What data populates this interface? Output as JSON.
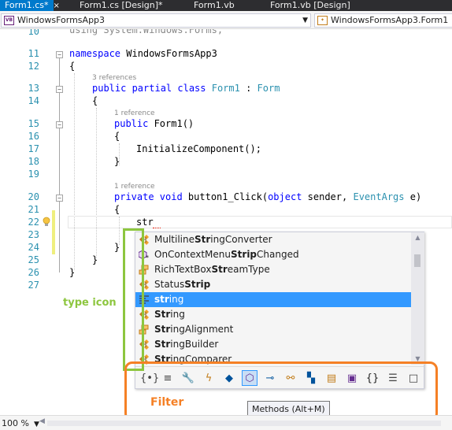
{
  "tabs": [
    {
      "label": "Form1.cs*",
      "active": true
    },
    {
      "label": "Form1.cs [Design]*",
      "active": false
    },
    {
      "label": "Form1.vb",
      "active": false
    },
    {
      "label": "Form1.vb [Design]",
      "active": false
    }
  ],
  "navbar": {
    "project_combo": "WindowsFormsApp3",
    "project_icon": "VB",
    "type_combo": "WindowsFormsApp3.Form1"
  },
  "editor": {
    "line_numbers": [
      "10",
      "11",
      "12",
      "13",
      "14",
      "15",
      "16",
      "17",
      "18",
      "19",
      "20",
      "21",
      "22",
      "23",
      "24",
      "25",
      "26",
      "27"
    ],
    "partial_top_line": "using System.Windows.Forms;",
    "lines": {
      "l11_kw": "namespace",
      "l11_name": " WindowsFormsApp3",
      "l12": "{",
      "lens_class": "3 references",
      "l13_kw": "public partial class ",
      "l13_type": "Form1",
      "l13_colon": " : ",
      "l13_base": "Form",
      "l14": "{",
      "lens_ctor": "1 reference",
      "l15_kw": "public ",
      "l15_name": "Form1()",
      "l16": "{",
      "l17": "InitializeComponent();",
      "l18": "}",
      "lens_click": "1 reference",
      "l20_kw": "private void ",
      "l20_name": "button1_Click(",
      "l20_kw2": "object",
      "l20_sender": " sender, ",
      "l20_type": "EventArgs",
      "l20_e": " e)",
      "l21": "{",
      "l22": "str",
      "l24": "}",
      "l25": "}",
      "l26": "}"
    }
  },
  "completion": {
    "items": [
      {
        "pre": "Multiline",
        "bold": "Str",
        "post": "ingConverter",
        "icon": "class-icon",
        "selected": false
      },
      {
        "pre": "OnContextMenu",
        "bold": "Strip",
        "post": "Changed",
        "icon": "event-method-icon",
        "selected": false
      },
      {
        "pre": "RichTextBox",
        "bold": "Str",
        "post": "eamType",
        "icon": "enum-icon",
        "selected": false
      },
      {
        "pre": "Status",
        "bold": "Strip",
        "post": "",
        "icon": "class-icon",
        "selected": false
      },
      {
        "pre": "",
        "bold": "str",
        "post": "ing",
        "icon": "keyword-icon",
        "selected": true
      },
      {
        "pre": "",
        "bold": "Str",
        "post": "ing",
        "icon": "class-icon",
        "selected": false
      },
      {
        "pre": "",
        "bold": "Str",
        "post": "ingAlignment",
        "icon": "enum-icon",
        "selected": false
      },
      {
        "pre": "",
        "bold": "Str",
        "post": "ingBuilder",
        "icon": "class-icon",
        "selected": false
      },
      {
        "pre": "",
        "bold": "Str",
        "post": "ingComparer",
        "icon": "class-icon",
        "selected": false
      }
    ],
    "filters": [
      {
        "name": "namespace-filter-icon",
        "glyph": "{•}",
        "color": "#424242",
        "hover": false
      },
      {
        "name": "keyword-filter-icon",
        "glyph": "≡",
        "color": "#424242",
        "hover": false
      },
      {
        "name": "property-filter-icon",
        "glyph": "🔧",
        "color": "#424242",
        "hover": false
      },
      {
        "name": "event-filter-icon",
        "glyph": "ϟ",
        "color": "#c27d1a",
        "hover": false
      },
      {
        "name": "field-filter-icon",
        "glyph": "◆",
        "color": "#00539c",
        "hover": false
      },
      {
        "name": "method-filter-icon",
        "glyph": "⬡",
        "color": "#652d90",
        "hover": true
      },
      {
        "name": "interface-filter-icon",
        "glyph": "⊸",
        "color": "#00539c",
        "hover": false
      },
      {
        "name": "class-filter-icon",
        "glyph": "⚯",
        "color": "#c27d1a",
        "hover": false
      },
      {
        "name": "struct-filter-icon",
        "glyph": "▚",
        "color": "#00539c",
        "hover": false
      },
      {
        "name": "enum-filter-icon",
        "glyph": "▤",
        "color": "#c27d1a",
        "hover": false
      },
      {
        "name": "delegate-filter-icon",
        "glyph": "▣",
        "color": "#652d90",
        "hover": false
      },
      {
        "name": "module-filter-icon",
        "glyph": "{}",
        "color": "#1e1e1e",
        "hover": false
      },
      {
        "name": "snippet-filter-icon",
        "glyph": "☰",
        "color": "#424242",
        "hover": false
      },
      {
        "name": "local-filter-icon",
        "glyph": "□",
        "color": "#424242",
        "hover": false
      }
    ],
    "tooltip": "Methods (Alt+M)"
  },
  "annotations": {
    "type_icon_label": "type icon",
    "filter_label": "Filter",
    "type_color": "#8dc63f",
    "filter_color": "#f58025"
  },
  "status": {
    "zoom": "100 %"
  }
}
